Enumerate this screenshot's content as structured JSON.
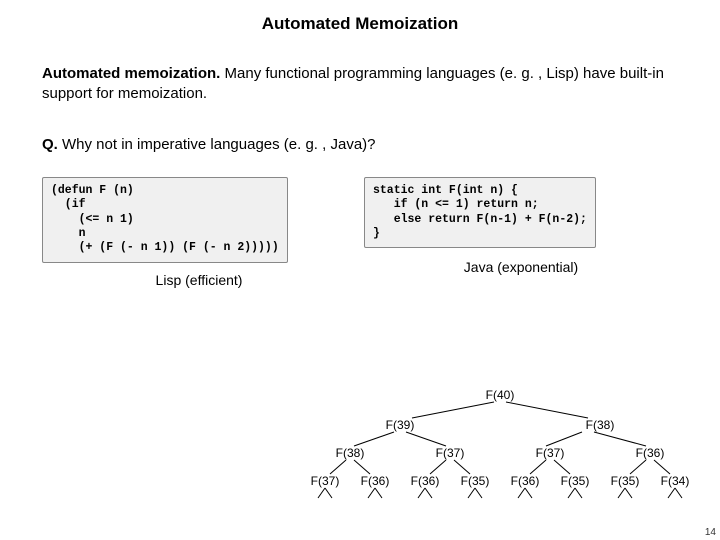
{
  "title": "Automated Memoization",
  "p1_lead": "Automated memoization.",
  "p1_rest": "  Many functional programming languages (e. g. , Lisp) have built-in support for memoization.",
  "q_lead": "Q.",
  "q_rest": "  Why not in imperative languages (e. g. , Java)?",
  "lisp_code": "(defun F (n)\n  (if\n    (<= n 1)\n    n\n    (+ (F (- n 1)) (F (- n 2)))))",
  "lisp_caption": "Lisp (efficient)",
  "java_code": "static int F(int n) {\n   if (n <= 1) return n;\n   else return F(n-1) + F(n-2);\n}",
  "java_caption": "Java (exponential)",
  "tree": {
    "root": "F(40)",
    "l2": [
      "F(39)",
      "F(38)"
    ],
    "l3": [
      "F(38)",
      "F(37)",
      "F(37)",
      "F(36)"
    ],
    "l4": [
      "F(37)",
      "F(36)",
      "F(36)",
      "F(35)",
      "F(36)",
      "F(35)",
      "F(35)",
      "F(34)"
    ]
  },
  "page_number": "14"
}
